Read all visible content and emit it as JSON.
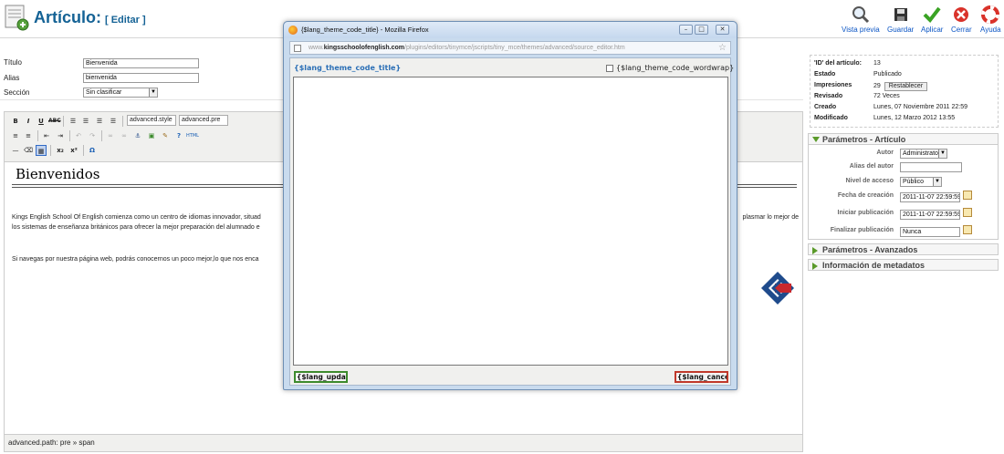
{
  "header": {
    "title": "Artículo:",
    "subtitle": "[ Editar ]"
  },
  "toolbar_buttons": [
    {
      "label": "Vista previa",
      "icon": "magnifier-icon"
    },
    {
      "label": "Guardar",
      "icon": "save-disk-icon"
    },
    {
      "label": "Aplicar",
      "icon": "checkmark-icon"
    },
    {
      "label": "Cerrar",
      "icon": "close-icon"
    },
    {
      "label": "Ayuda",
      "icon": "lifebuoy-icon"
    }
  ],
  "form": {
    "title_label": "Título",
    "title_value": "Bienvenida",
    "alias_label": "Alias",
    "alias_value": "bienvenida",
    "section_label": "Sección",
    "section_value": "Sin clasificar"
  },
  "editor": {
    "style_select": "advanced.style",
    "format_select": "advanced.pre",
    "content_heading": "Bienvenidos",
    "paragraph1": "Kings English School Of English comienza como un centro de idiomas innovador, situad",
    "paragraph1_cont": "plasmar lo mejor de",
    "paragraph1_line2": "los sistemas de enseñanza británicos para ofrecer la mejor preparación del alumnado e",
    "paragraph2": "Si navegas por nuestra página web, podrás conocernos un poco mejor,lo que nos enca",
    "status_path": "advanced.path: pre » span"
  },
  "info": {
    "id_label": "'ID' del artículo:",
    "id_value": "13",
    "state_label": "Estado",
    "state_value": "Publicado",
    "hits_label": "Impresiones",
    "hits_value": "29",
    "reset_label": "Restablecer",
    "revised_label": "Revisado",
    "revised_value": "72 Veces",
    "created_label": "Creado",
    "created_value": "Lunes, 07 Noviembre 2011 22:59",
    "modified_label": "Modificado",
    "modified_value": "Lunes, 12 Marzo 2012 13:55"
  },
  "params": {
    "heading": "Parámetros - Artículo",
    "author_label": "Autor",
    "author_value": "Administrator",
    "author_alias_label": "Alias del autor",
    "author_alias_value": "",
    "access_label": "Nivel de acceso",
    "access_value": "Público",
    "created_date_label": "Fecha de creación",
    "created_date_value": "2011-11-07 22:59:59",
    "publish_up_label": "Iniciar publicación",
    "publish_up_value": "2011-11-07 22:59:59",
    "publish_down_label": "Finalizar publicación",
    "publish_down_value": "Nunca"
  },
  "collapsed_panes": {
    "advanced": "Parámetros - Avanzados",
    "metadata": "Información de metadatos"
  },
  "popup": {
    "window_title": "{$lang_theme_code_title} - Mozilla Firefox",
    "url_domain_prefix": "www.",
    "url_domain": "kingsschoolofenglish.com",
    "url_path": "/plugins/editors/tinymce/jscripts/tiny_mce/themes/advanced/source_editor.htm",
    "heading": "{$lang_theme_code_title}",
    "wordwrap_label": "{$lang_theme_code_wordwrap}",
    "update_button": "{$lang_update}",
    "cancel_button": "{$lang_cancel}"
  },
  "colors": {
    "title_blue": "#146295",
    "toolbar_link": "#0b55c4",
    "popup_chrome": "#c9dbee",
    "update_border": "#3d8b2d",
    "cancel_border": "#c0392b",
    "pane_arrow": "#5a9a2a"
  }
}
